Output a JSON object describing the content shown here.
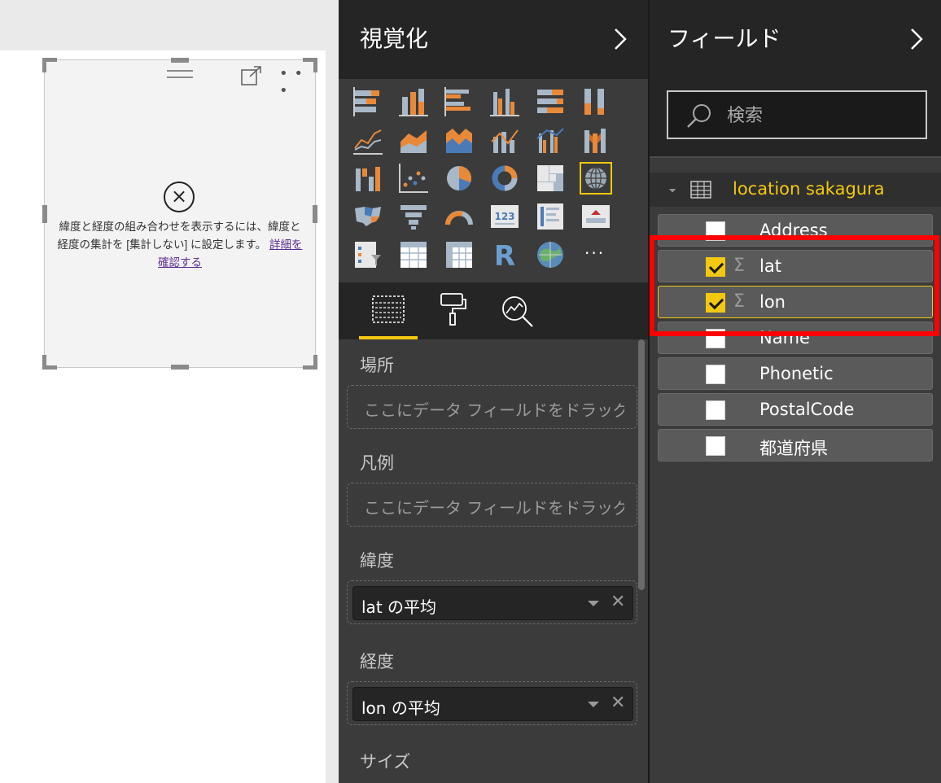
{
  "canvas": {
    "error_message": "緯度と経度の組み合わせを表示するには、緯度と経度の集計を [集計しない] に設定します。",
    "error_link": "詳細を確認する"
  },
  "visualizations": {
    "title": "視覚化",
    "more_label": "···",
    "tabs": [
      "fields-tab",
      "format-tab",
      "analytics-tab"
    ],
    "wells": [
      {
        "label": "場所",
        "placeholder": "ここにデータ フィールドをドラッグし..."
      },
      {
        "label": "凡例",
        "placeholder": "ここにデータ フィールドをドラッグし..."
      },
      {
        "label": "緯度",
        "value": "lat の平均"
      },
      {
        "label": "経度",
        "value": "lon の平均"
      },
      {
        "label": "サイズ"
      }
    ]
  },
  "fields": {
    "title": "フィールド",
    "search_placeholder": "検索",
    "table_name": "location sakagura",
    "items": [
      {
        "label": "Address",
        "checked": false,
        "aggregate": false
      },
      {
        "label": "lat",
        "checked": true,
        "aggregate": true
      },
      {
        "label": "lon",
        "checked": true,
        "aggregate": true
      },
      {
        "label": "Name",
        "checked": false,
        "aggregate": false
      },
      {
        "label": "Phonetic",
        "checked": false,
        "aggregate": false
      },
      {
        "label": "PostalCode",
        "checked": false,
        "aggregate": false
      },
      {
        "label": "都道府県",
        "checked": false,
        "aggregate": false
      }
    ]
  },
  "colors": {
    "accent": "#f2c811",
    "highlight": "#ff0000",
    "link": "#5b2d90"
  }
}
